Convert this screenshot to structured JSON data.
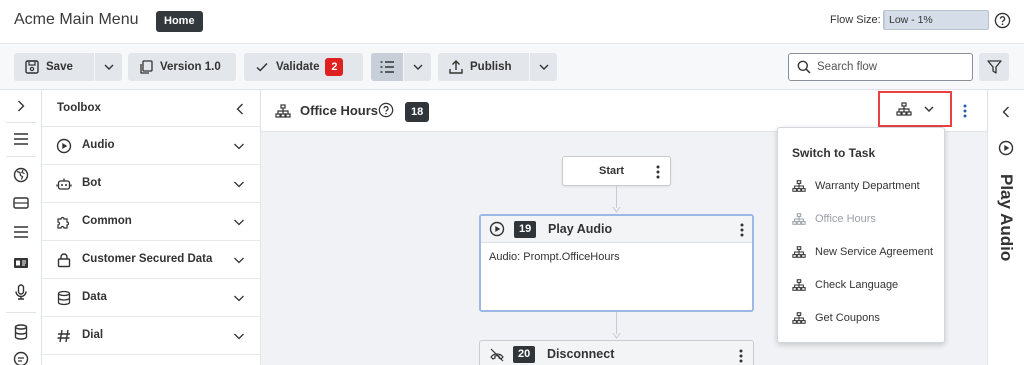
{
  "app": {
    "title": "Acme Main Menu",
    "home_label": "Home"
  },
  "flow_size": {
    "label": "Flow Size:",
    "value_text": "Low - 1%",
    "percent": 1
  },
  "toolbar": {
    "save_label": "Save",
    "version_label": "Version 1.0",
    "validate_label": "Validate",
    "validate_count": "2",
    "publish_label": "Publish",
    "search_placeholder": "Search flow"
  },
  "toolbox": {
    "title": "Toolbox",
    "items": [
      {
        "label": "Audio",
        "icon": "play-circle-icon"
      },
      {
        "label": "Bot",
        "icon": "bot-icon"
      },
      {
        "label": "Common",
        "icon": "puzzle-icon"
      },
      {
        "label": "Customer Secured Data",
        "icon": "lock-icon"
      },
      {
        "label": "Data",
        "icon": "database-icon"
      },
      {
        "label": "Dial",
        "icon": "hash-icon"
      }
    ]
  },
  "canvas_header": {
    "title": "Office Hours",
    "count": "18"
  },
  "nodes": {
    "start": {
      "label": "Start"
    },
    "play_audio": {
      "number": "19",
      "name": "Play Audio",
      "body": "Audio: Prompt.OfficeHours"
    },
    "disconnect": {
      "number": "20",
      "name": "Disconnect"
    }
  },
  "switch_task": {
    "title": "Switch to Task",
    "items": [
      {
        "label": "Warranty Department",
        "disabled": false
      },
      {
        "label": "Office Hours",
        "disabled": true
      },
      {
        "label": "New Service Agreement",
        "disabled": false
      },
      {
        "label": "Check Language",
        "disabled": false
      },
      {
        "label": "Get Coupons",
        "disabled": false
      }
    ]
  },
  "right_panel": {
    "title": "Play Audio"
  },
  "colors": {
    "accent_border": "#9cb8e6",
    "highlight": "#e84141",
    "badge_red": "#e02020",
    "dark_badge": "#2f3539"
  }
}
